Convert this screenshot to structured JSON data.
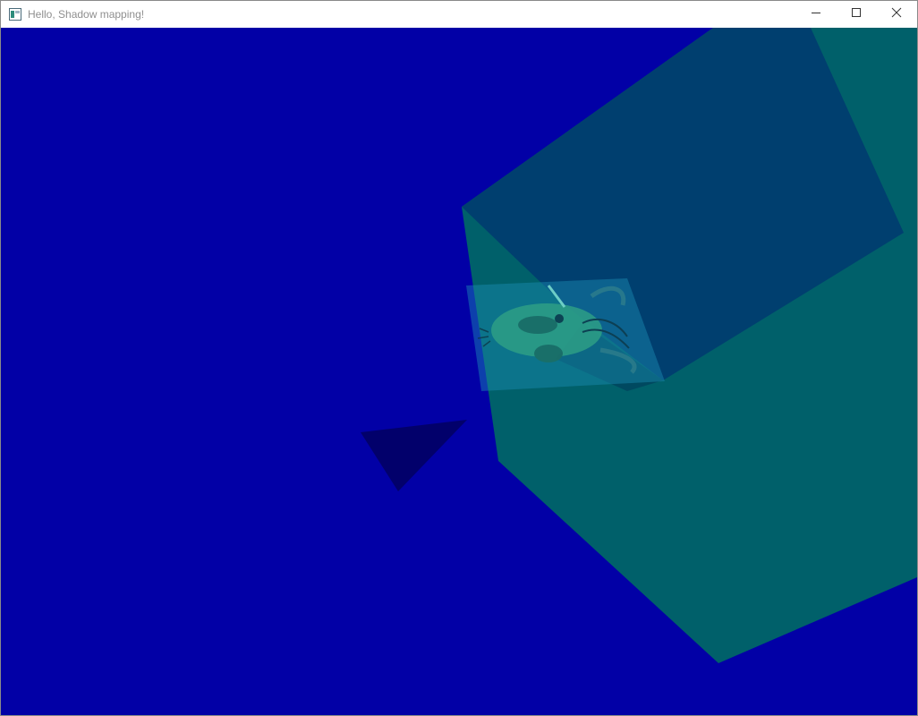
{
  "window": {
    "title": "Hello, Shadow mapping!",
    "icon": "app-window-icon",
    "controls": {
      "minimize_icon": "minimize-icon",
      "maximize_icon": "maximize-icon",
      "close_icon": "close-icon"
    }
  },
  "scene": {
    "background_color": "#0200a6",
    "cube_front_color": "#00606a",
    "cube_top_color": "#003f6f",
    "cube_shadow_color": "#00435e",
    "triangle_color": "#02006b",
    "plane_color": "#1b8fb3"
  }
}
